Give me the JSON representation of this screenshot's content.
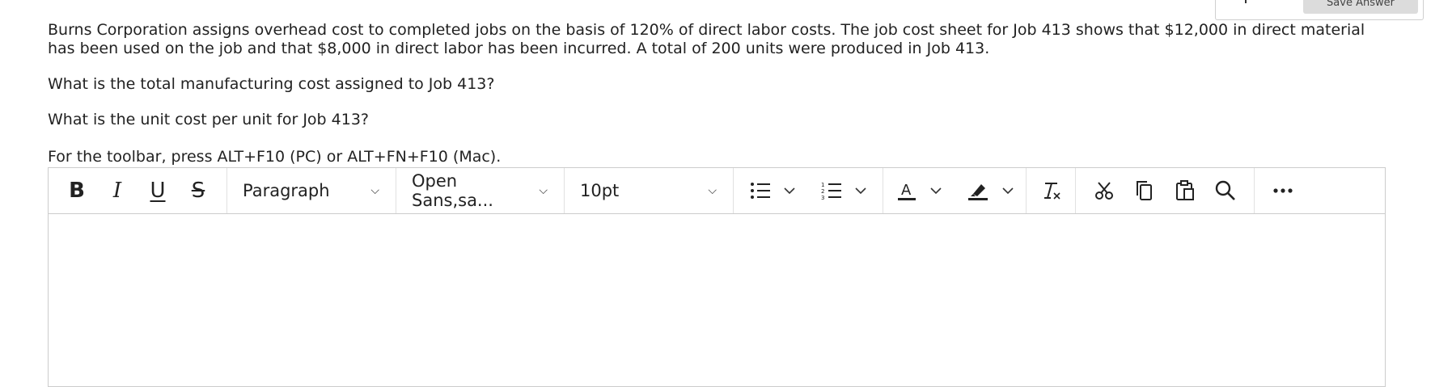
{
  "question": {
    "intro": "Burns Corporation assigns overhead cost to completed jobs on the basis of 120% of direct labor costs.  The job cost sheet for Job 413 shows that $12,000 in direct material has been used on the job and that $8,000 in direct labor has been incurred.  A total of 200 units were produced in Job 413.",
    "q1": "What is the total manufacturing cost assigned to Job 413?",
    "q2": "What is the unit cost per unit for Job 413?"
  },
  "editor": {
    "hint": "For the toolbar, press ALT+F10 (PC) or ALT+FN+F10 (Mac).",
    "toolbar": {
      "bold": "B",
      "italic": "I",
      "underline": "U",
      "strike": "S",
      "block_format": "Paragraph",
      "font_family": "Open Sans,sa...",
      "font_size": "10pt"
    }
  },
  "top_box": {
    "save_label": "Save Answer"
  },
  "icons": {
    "bullet_list": "bullet-list-icon",
    "numbered_list": "numbered-list-icon",
    "text_color": "text-color-icon",
    "highlight": "highlight-icon",
    "clear_format": "clear-format-icon",
    "cut": "scissors-icon",
    "copy": "copy-icon",
    "paste": "clipboard-icon",
    "find": "search-icon",
    "more": "more-icon"
  },
  "colors": {
    "toolbar_border": "#cccccc",
    "save_button_bg": "#dcdcdc",
    "text": "#222222"
  }
}
